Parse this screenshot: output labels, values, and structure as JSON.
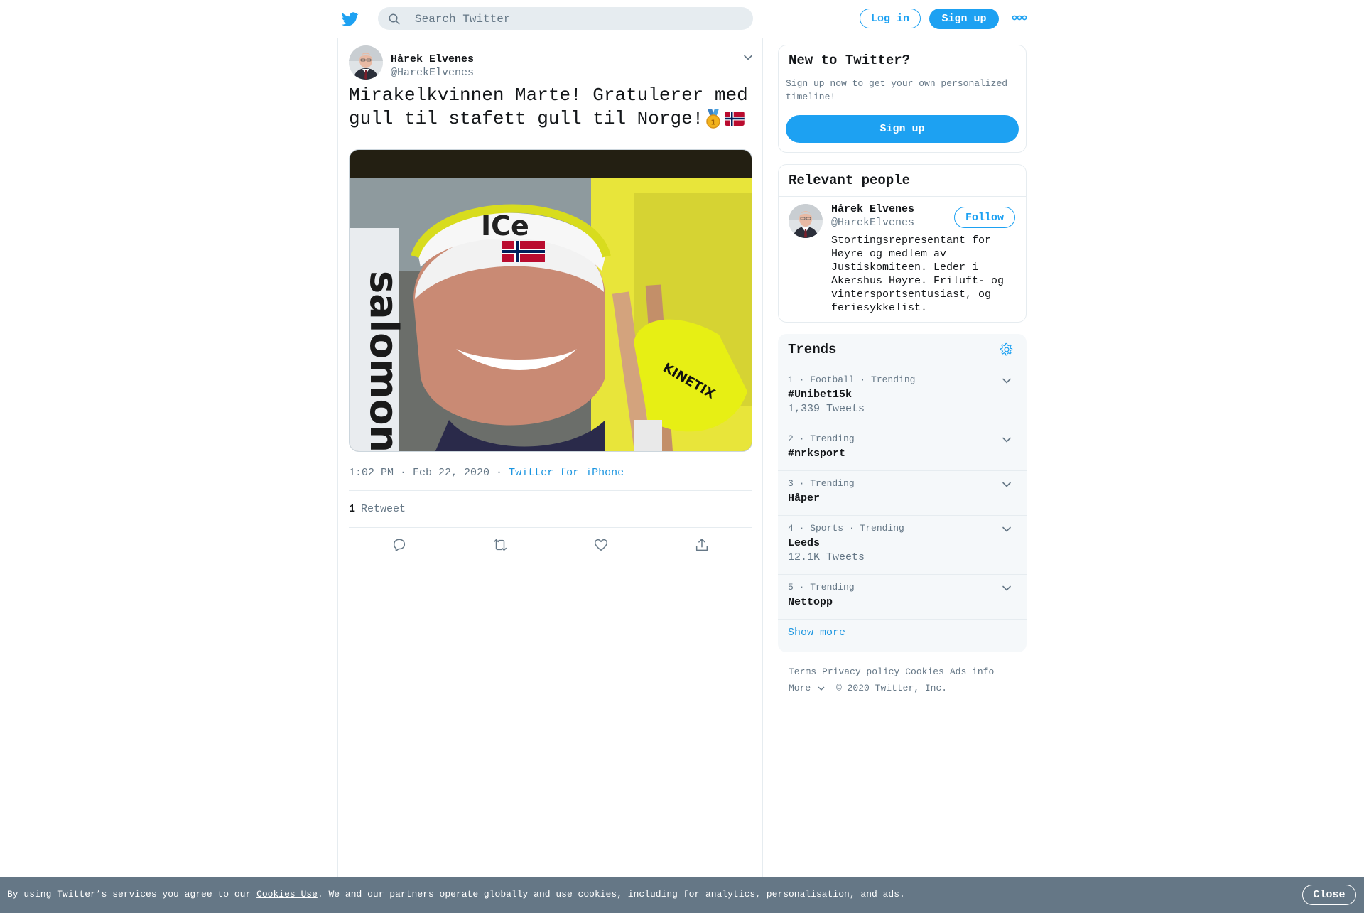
{
  "topbar": {
    "search_placeholder": "Search Twitter",
    "login_label": "Log in",
    "signup_label": "Sign up"
  },
  "tweet": {
    "author_name": "Hårek Elvenes",
    "author_handle": "@HarekElvenes",
    "text": "Mirakelkvinnen Marte! Gratulerer med gull til stafett gull til Norge!",
    "emoji": [
      "medal-icon",
      "norway-flag-icon"
    ],
    "timestamp": "1:02 PM · Feb 22, 2020",
    "separator": " · ",
    "source": "Twitter for iPhone",
    "retweet_count": "1",
    "retweet_label": "Retweet"
  },
  "new_to_twitter": {
    "title": "New to Twitter?",
    "description": "Sign up now to get your own personalized timeline!",
    "signup_label": "Sign up"
  },
  "relevant_people": {
    "title": "Relevant people",
    "person": {
      "name": "Hårek Elvenes",
      "handle": "@HarekElvenes",
      "follow_label": "Follow",
      "bio": "Stortingsrepresentant for Høyre og medlem av Justiskomiteen. Leder i Akershus Høyre. Friluft- og vintersportsentusiast, og feriesykkelist."
    }
  },
  "trends": {
    "title": "Trends",
    "items": [
      {
        "meta": "1 · Football · Trending",
        "name": "#Unibet15k",
        "count": "1,339 Tweets"
      },
      {
        "meta": "2 · Trending",
        "name": "#nrksport",
        "count": ""
      },
      {
        "meta": "3 · Trending",
        "name": "Håper",
        "count": ""
      },
      {
        "meta": "4 · Sports · Trending",
        "name": "Leeds",
        "count": "12.1K Tweets"
      },
      {
        "meta": "5 · Trending",
        "name": "Nettopp",
        "count": ""
      }
    ],
    "show_more": "Show more"
  },
  "footer": {
    "links": [
      "Terms",
      "Privacy policy",
      "Cookies",
      "Ads info"
    ],
    "more": "More",
    "copyright": "© 2020 Twitter, Inc."
  },
  "cookie_bar": {
    "prefix": "By using Twitter’s services you agree to our ",
    "link": "Cookies Use",
    "suffix": ". We and our partners operate globally and use cookies, including for analytics, personalisation, and ads.",
    "close_label": "Close"
  },
  "colors": {
    "accent": "#1da1f2",
    "link": "#1b95e0",
    "muted": "#657786",
    "cookie_bg": "#657786"
  }
}
